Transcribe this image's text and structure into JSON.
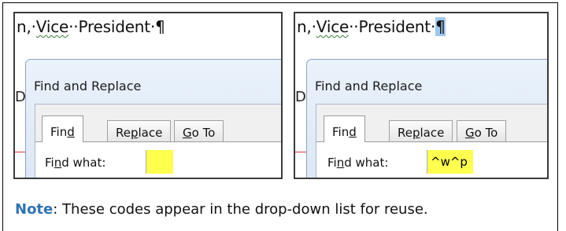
{
  "document_line_left": {
    "prefix": "n,·",
    "vice": "Vice",
    "sep": "··",
    "president": "President",
    "dot": "·",
    "pilcrow": "¶"
  },
  "document_line_right": {
    "prefix": "n,·",
    "vice": "Vice",
    "sep": "··",
    "president": "President",
    "dot": "·",
    "pilcrow": "¶"
  },
  "left_edge_letters": {
    "left": "De",
    "right": "D"
  },
  "dialog": {
    "title": "Find and Replace",
    "tabs": [
      {
        "label_pre": "Fin",
        "label_ul": "d",
        "label_post": ""
      },
      {
        "label_pre": "Re",
        "label_ul": "p",
        "label_post": "lace"
      },
      {
        "label_pre": "",
        "label_ul": "G",
        "label_post": "o To"
      }
    ],
    "find_label_pre": "Fi",
    "find_label_ul": "n",
    "find_label_post": "d what:"
  },
  "find_value_left": "",
  "find_value_right": "^w^p",
  "note": {
    "lead": "Note",
    "text": ": These codes appear in the drop-down list for reuse."
  },
  "colors": {
    "highlight": "#ffff4d",
    "selection": "#9fc7ef",
    "note_lead": "#2e74b5"
  }
}
